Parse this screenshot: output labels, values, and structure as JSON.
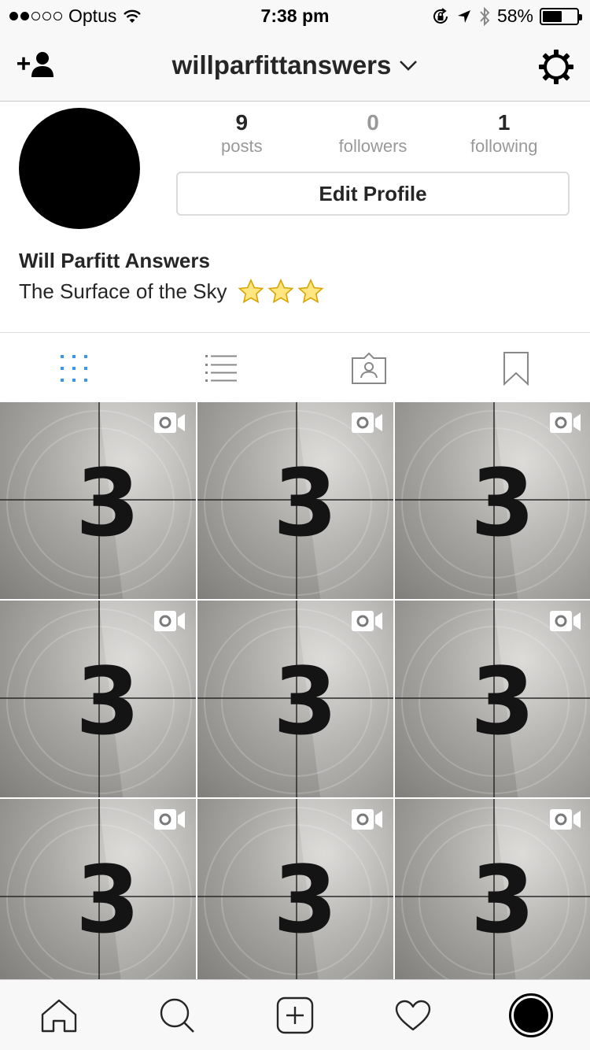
{
  "status_bar": {
    "carrier": "Optus",
    "time": "7:38 pm",
    "battery_text": "58%",
    "battery_level": 0.58,
    "signal_bars_filled": 2,
    "signal_bars_total": 5
  },
  "nav": {
    "username": "willparfittanswers",
    "left_icon": "add-person-icon",
    "right_icon": "gear-icon"
  },
  "profile": {
    "stats": [
      {
        "count": "9",
        "label": "posts"
      },
      {
        "count": "0",
        "label": "followers"
      },
      {
        "count": "1",
        "label": "following"
      }
    ],
    "edit_button": "Edit Profile",
    "name": "Will Parfitt Answers",
    "bio": "The Surface of the Sky"
  },
  "tabs": [
    "grid-icon",
    "list-icon",
    "tagged-icon",
    "bookmark-icon"
  ],
  "grid": {
    "posts": [
      {
        "digit": "3",
        "type": "video"
      },
      {
        "digit": "3",
        "type": "video"
      },
      {
        "digit": "3",
        "type": "video"
      },
      {
        "digit": "3",
        "type": "video"
      },
      {
        "digit": "3",
        "type": "video"
      },
      {
        "digit": "3",
        "type": "video"
      },
      {
        "digit": "3",
        "type": "video"
      },
      {
        "digit": "3",
        "type": "video"
      },
      {
        "digit": "3",
        "type": "video"
      }
    ]
  },
  "tab_bar": [
    "home-icon",
    "search-icon",
    "add-post-icon",
    "heart-icon",
    "profile-icon"
  ],
  "colors": {
    "accent": "#3897f0",
    "bar_bg": "#f8f8f8",
    "text": "#262626",
    "muted": "#999999"
  }
}
